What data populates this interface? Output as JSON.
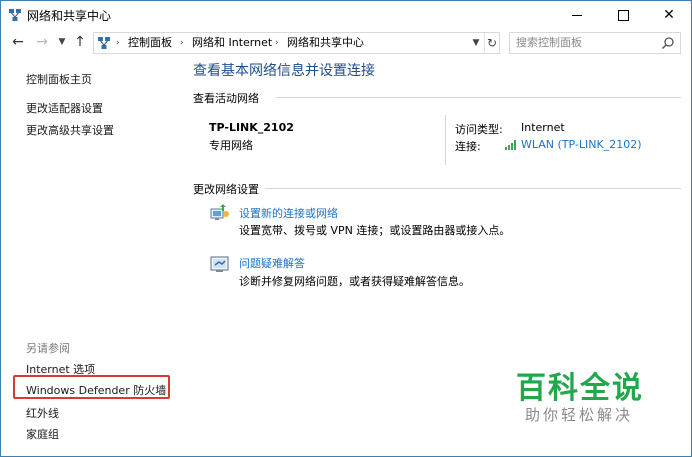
{
  "window": {
    "title": "网络和共享中心",
    "controls": {
      "minimize": "—",
      "maximize": "□",
      "close": "✕"
    }
  },
  "nav": {
    "back_icon": "back-arrow-icon",
    "forward_icon": "forward-arrow-icon",
    "recent_icon": "chevron-down-icon",
    "up_icon": "up-arrow-icon",
    "breadcrumbs": [
      "控制面板",
      "网络和 Internet",
      "网络和共享中心"
    ],
    "separator": "›",
    "search_placeholder": "搜索控制面板"
  },
  "sidebar": {
    "top_links": [
      "控制面板主页",
      "更改适配器设置",
      "更改高级共享设置"
    ],
    "see_also_caption": "另请参阅",
    "see_also_links": [
      "Internet 选项",
      "Windows Defender 防火墙",
      "红外线",
      "家庭组"
    ],
    "highlighted_item": "Windows Defender 防火墙",
    "highlight_color": "#d83a3a"
  },
  "main": {
    "heading": "查看基本网络信息并设置连接",
    "active_section": "查看活动网络",
    "network": {
      "name": "TP-LINK_2102",
      "type": "专用网络",
      "access_type_label": "访问类型:",
      "access_type_value": "Internet",
      "connection_label": "连接:",
      "connection_value": "WLAN (TP-LINK_2102)"
    },
    "change_section": "更改网络设置",
    "tasks": [
      {
        "icon": "network-setup-icon",
        "link": "设置新的连接或网络",
        "desc": "设置宽带、拨号或 VPN 连接；或设置路由器或接入点。"
      },
      {
        "icon": "troubleshoot-icon",
        "link": "问题疑难解答",
        "desc": "诊断并修复网络问题，或者获得疑难解答信息。"
      }
    ]
  },
  "watermark": {
    "title": "百科全说",
    "subtitle": "助你轻松解决",
    "color": "#22a84a"
  },
  "colors": {
    "heading": "#1e4e8c",
    "link": "#1a73c8",
    "window_border": "#3c7fb1"
  }
}
